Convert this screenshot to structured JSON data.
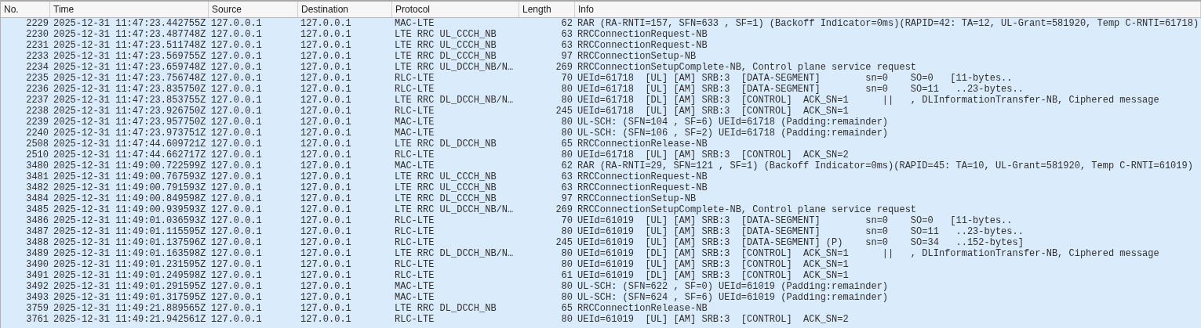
{
  "columns": [
    "No.",
    "Time",
    "Source",
    "Destination",
    "Protocol",
    "Length",
    "Info"
  ],
  "rows": [
    [
      "2229",
      "2025-12-31 11:47:23.442755Z",
      "127.0.0.1",
      "127.0.0.1",
      "MAC-LTE",
      "62",
      "RAR (RA-RNTI=157, SFN=633 , SF=1) (Backoff Indicator=0ms)(RAPID=42: TA=12, UL-Grant=581920, Temp C-RNTI=61718)"
    ],
    [
      "2230",
      "2025-12-31 11:47:23.487748Z",
      "127.0.0.1",
      "127.0.0.1",
      "LTE RRC UL_CCCH_NB",
      "63",
      "RRCConnectionRequest-NB"
    ],
    [
      "2231",
      "2025-12-31 11:47:23.511748Z",
      "127.0.0.1",
      "127.0.0.1",
      "LTE RRC UL_CCCH_NB",
      "63",
      "RRCConnectionRequest-NB"
    ],
    [
      "2233",
      "2025-12-31 11:47:23.569755Z",
      "127.0.0.1",
      "127.0.0.1",
      "LTE RRC DL_CCCH_NB",
      "97",
      "RRCConnectionSetup-NB"
    ],
    [
      "2234",
      "2025-12-31 11:47:23.659748Z",
      "127.0.0.1",
      "127.0.0.1",
      "LTE RRC UL_DCCH_NB/N…",
      "269",
      "RRCConnectionSetupComplete-NB, Control plane service request"
    ],
    [
      "2235",
      "2025-12-31 11:47:23.756748Z",
      "127.0.0.1",
      "127.0.0.1",
      "RLC-LTE",
      "70",
      "UEId=61718  [UL] [AM] SRB:3  [DATA-SEGMENT]        sn=0    SO=0   [11-bytes.."
    ],
    [
      "2236",
      "2025-12-31 11:47:23.835750Z",
      "127.0.0.1",
      "127.0.0.1",
      "RLC-LTE",
      "80",
      "UEId=61718  [UL] [AM] SRB:3  [DATA-SEGMENT]        sn=0    SO=11   ..23-bytes.."
    ],
    [
      "2237",
      "2025-12-31 11:47:23.853755Z",
      "127.0.0.1",
      "127.0.0.1",
      "LTE RRC DL_DCCH_NB/N…",
      "80",
      "UEId=61718  [DL] [AM] SRB:3  [CONTROL]  ACK_SN=1      ||   , DLInformationTransfer-NB, Ciphered message"
    ],
    [
      "2238",
      "2025-12-31 11:47:23.926750Z",
      "127.0.0.1",
      "127.0.0.1",
      "RLC-LTE",
      "245",
      "UEId=61718  [UL] [AM] SRB:3  [CONTROL]  ACK_SN=1"
    ],
    [
      "2239",
      "2025-12-31 11:47:23.957750Z",
      "127.0.0.1",
      "127.0.0.1",
      "MAC-LTE",
      "80",
      "UL-SCH: (SFN=104 , SF=6) UEId=61718 (Padding:remainder)"
    ],
    [
      "2240",
      "2025-12-31 11:47:23.973751Z",
      "127.0.0.1",
      "127.0.0.1",
      "MAC-LTE",
      "80",
      "UL-SCH: (SFN=106 , SF=2) UEId=61718 (Padding:remainder)"
    ],
    [
      "2508",
      "2025-12-31 11:47:44.609721Z",
      "127.0.0.1",
      "127.0.0.1",
      "LTE RRC DL_DCCH_NB",
      "65",
      "RRCConnectionRelease-NB"
    ],
    [
      "2510",
      "2025-12-31 11:47:44.662717Z",
      "127.0.0.1",
      "127.0.0.1",
      "RLC-LTE",
      "80",
      "UEId=61718  [UL] [AM] SRB:3  [CONTROL]  ACK_SN=2"
    ],
    [
      "3480",
      "2025-12-31 11:49:00.722599Z",
      "127.0.0.1",
      "127.0.0.1",
      "MAC-LTE",
      "62",
      "RAR (RA-RNTI=29, SFN=121 , SF=1) (Backoff Indicator=0ms)(RAPID=45: TA=10, UL-Grant=581920, Temp C-RNTI=61019)"
    ],
    [
      "3481",
      "2025-12-31 11:49:00.767593Z",
      "127.0.0.1",
      "127.0.0.1",
      "LTE RRC UL_CCCH_NB",
      "63",
      "RRCConnectionRequest-NB"
    ],
    [
      "3482",
      "2025-12-31 11:49:00.791593Z",
      "127.0.0.1",
      "127.0.0.1",
      "LTE RRC UL_CCCH_NB",
      "63",
      "RRCConnectionRequest-NB"
    ],
    [
      "3484",
      "2025-12-31 11:49:00.849598Z",
      "127.0.0.1",
      "127.0.0.1",
      "LTE RRC DL_CCCH_NB",
      "97",
      "RRCConnectionSetup-NB"
    ],
    [
      "3485",
      "2025-12-31 11:49:00.939593Z",
      "127.0.0.1",
      "127.0.0.1",
      "LTE RRC UL_DCCH_NB/N…",
      "269",
      "RRCConnectionSetupComplete-NB, Control plane service request"
    ],
    [
      "3486",
      "2025-12-31 11:49:01.036593Z",
      "127.0.0.1",
      "127.0.0.1",
      "RLC-LTE",
      "70",
      "UEId=61019  [UL] [AM] SRB:3  [DATA-SEGMENT]        sn=0    SO=0   [11-bytes.."
    ],
    [
      "3487",
      "2025-12-31 11:49:01.115595Z",
      "127.0.0.1",
      "127.0.0.1",
      "RLC-LTE",
      "80",
      "UEId=61019  [UL] [AM] SRB:3  [DATA-SEGMENT]        sn=0    SO=11   ..23-bytes.."
    ],
    [
      "3488",
      "2025-12-31 11:49:01.137596Z",
      "127.0.0.1",
      "127.0.0.1",
      "RLC-LTE",
      "245",
      "UEId=61019  [UL] [AM] SRB:3  [DATA-SEGMENT] (P)    sn=0    SO=34   ..152-bytes]"
    ],
    [
      "3489",
      "2025-12-31 11:49:01.163598Z",
      "127.0.0.1",
      "127.0.0.1",
      "LTE RRC DL_DCCH_NB/N…",
      "80",
      "UEId=61019  [DL] [AM] SRB:3  [CONTROL]  ACK_SN=1      ||   , DLInformationTransfer-NB, Ciphered message"
    ],
    [
      "3490",
      "2025-12-31 11:49:01.231595Z",
      "127.0.0.1",
      "127.0.0.1",
      "RLC-LTE",
      "80",
      "UEId=61019  [UL] [AM] SRB:3  [CONTROL]  ACK_SN=1"
    ],
    [
      "3491",
      "2025-12-31 11:49:01.249598Z",
      "127.0.0.1",
      "127.0.0.1",
      "RLC-LTE",
      "61",
      "UEId=61019  [DL] [AM] SRB:3  [CONTROL]  ACK_SN=1"
    ],
    [
      "3492",
      "2025-12-31 11:49:01.291595Z",
      "127.0.0.1",
      "127.0.0.1",
      "MAC-LTE",
      "80",
      "UL-SCH: (SFN=622 , SF=0) UEId=61019 (Padding:remainder)"
    ],
    [
      "3493",
      "2025-12-31 11:49:01.317595Z",
      "127.0.0.1",
      "127.0.0.1",
      "MAC-LTE",
      "80",
      "UL-SCH: (SFN=624 , SF=6) UEId=61019 (Padding:remainder)"
    ],
    [
      "3759",
      "2025-12-31 11:49:21.889565Z",
      "127.0.0.1",
      "127.0.0.1",
      "LTE RRC DL_DCCH_NB",
      "65",
      "RRCConnectionRelease-NB"
    ],
    [
      "3761",
      "2025-12-31 11:49:21.942561Z",
      "127.0.0.1",
      "127.0.0.1",
      "RLC-LTE",
      "80",
      "UEId=61019  [UL] [AM] SRB:3  [CONTROL]  ACK_SN=2"
    ]
  ]
}
